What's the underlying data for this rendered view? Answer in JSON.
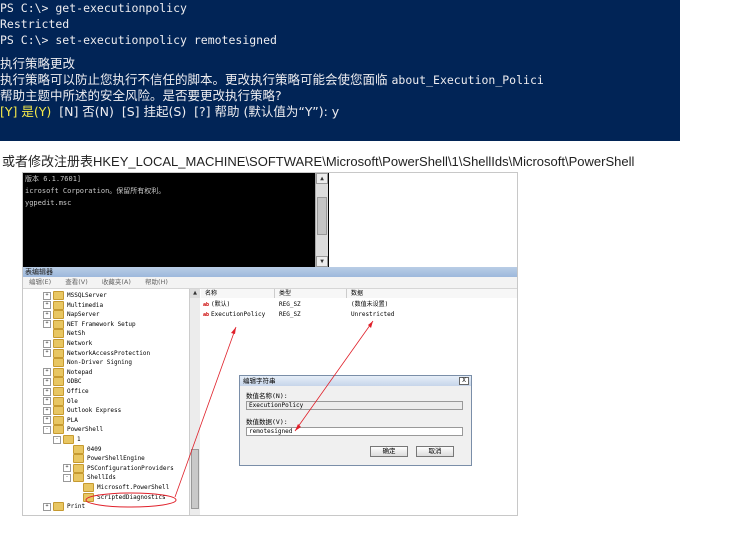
{
  "console": {
    "lines": [
      "PS C:\\> get-executionpolicy",
      "Restricted",
      "PS C:\\> set-executionpolicy remotesigned"
    ],
    "heading": "执行策略更改",
    "body_line1_cn": "执行策略可以防止您执行不信任的脚本。更改执行策略可能会使您面临 ",
    "body_line1_en": "about_Execution_Polici",
    "body_line2": "帮助主题中所述的安全风险。是否要更改执行策略?",
    "prompt_highlight": "[Y] 是(Y)",
    "prompt_rest": "  [N] 否(N)  [S] 挂起(S)  [?] 帮助 (默认值为“Y”): y"
  },
  "caption": "或者修改注册表HKEY_LOCAL_MACHINE\\SOFTWARE\\Microsoft\\PowerShell\\1\\ShellIds\\Microsoft\\PowerShell",
  "cmd": {
    "lines": [
      "版本 6.1.7601]",
      "icrosoft Corporation。保留所有权利。",
      "",
      "ygpedit.msc"
    ]
  },
  "regedit": {
    "title": "表编辑器",
    "menu": [
      "编辑(E)",
      "查看(V)",
      "收藏夹(A)",
      "帮助(H)"
    ],
    "tree": [
      {
        "label": "MSSQLServer",
        "depth": 0,
        "expander": "+"
      },
      {
        "label": "Multimedia",
        "depth": 0,
        "expander": "+"
      },
      {
        "label": "NapServer",
        "depth": 0,
        "expander": "+"
      },
      {
        "label": "NET Framework Setup",
        "depth": 0,
        "expander": "+"
      },
      {
        "label": "NetSh",
        "depth": 0,
        "expander": ""
      },
      {
        "label": "Network",
        "depth": 0,
        "expander": "+"
      },
      {
        "label": "NetworkAccessProtection",
        "depth": 0,
        "expander": "+"
      },
      {
        "label": "Non-Driver Signing",
        "depth": 0,
        "expander": ""
      },
      {
        "label": "Notepad",
        "depth": 0,
        "expander": "+"
      },
      {
        "label": "ODBC",
        "depth": 0,
        "expander": "+"
      },
      {
        "label": "Office",
        "depth": 0,
        "expander": "+"
      },
      {
        "label": "Ole",
        "depth": 0,
        "expander": "+"
      },
      {
        "label": "Outlook Express",
        "depth": 0,
        "expander": "+"
      },
      {
        "label": "PLA",
        "depth": 0,
        "expander": "+"
      },
      {
        "label": "PowerShell",
        "depth": 0,
        "expander": "-"
      },
      {
        "label": "1",
        "depth": 1,
        "expander": "-"
      },
      {
        "label": "0409",
        "depth": 2,
        "expander": ""
      },
      {
        "label": "PowerShellEngine",
        "depth": 2,
        "expander": ""
      },
      {
        "label": "PSConfigurationProviders",
        "depth": 2,
        "expander": "+"
      },
      {
        "label": "ShellIds",
        "depth": 2,
        "expander": "-"
      },
      {
        "label": "Microsoft.PowerShell",
        "depth": 3,
        "expander": ""
      },
      {
        "label": "ScriptedDiagnostics",
        "depth": 3,
        "expander": ""
      },
      {
        "label": "Print",
        "depth": 0,
        "expander": "+"
      }
    ],
    "columns": [
      "名称",
      "类型",
      "数据"
    ],
    "values": [
      {
        "name": "(默认)",
        "type": "REG_SZ",
        "data": "(数值未设置)"
      },
      {
        "name": "ExecutionPolicy",
        "type": "REG_SZ",
        "data": "Unrestricted"
      }
    ]
  },
  "dialog": {
    "title": "编辑字符串",
    "close": "X",
    "name_label": "数值名称(N):",
    "name_value": "ExecutionPolicy",
    "data_label": "数值数据(V):",
    "data_value": "remotesigned",
    "ok": "确定",
    "cancel": "取消"
  },
  "colors": {
    "console_bg": "#012456",
    "highlight": "#f4e84a",
    "annotation": "#e0202a"
  }
}
